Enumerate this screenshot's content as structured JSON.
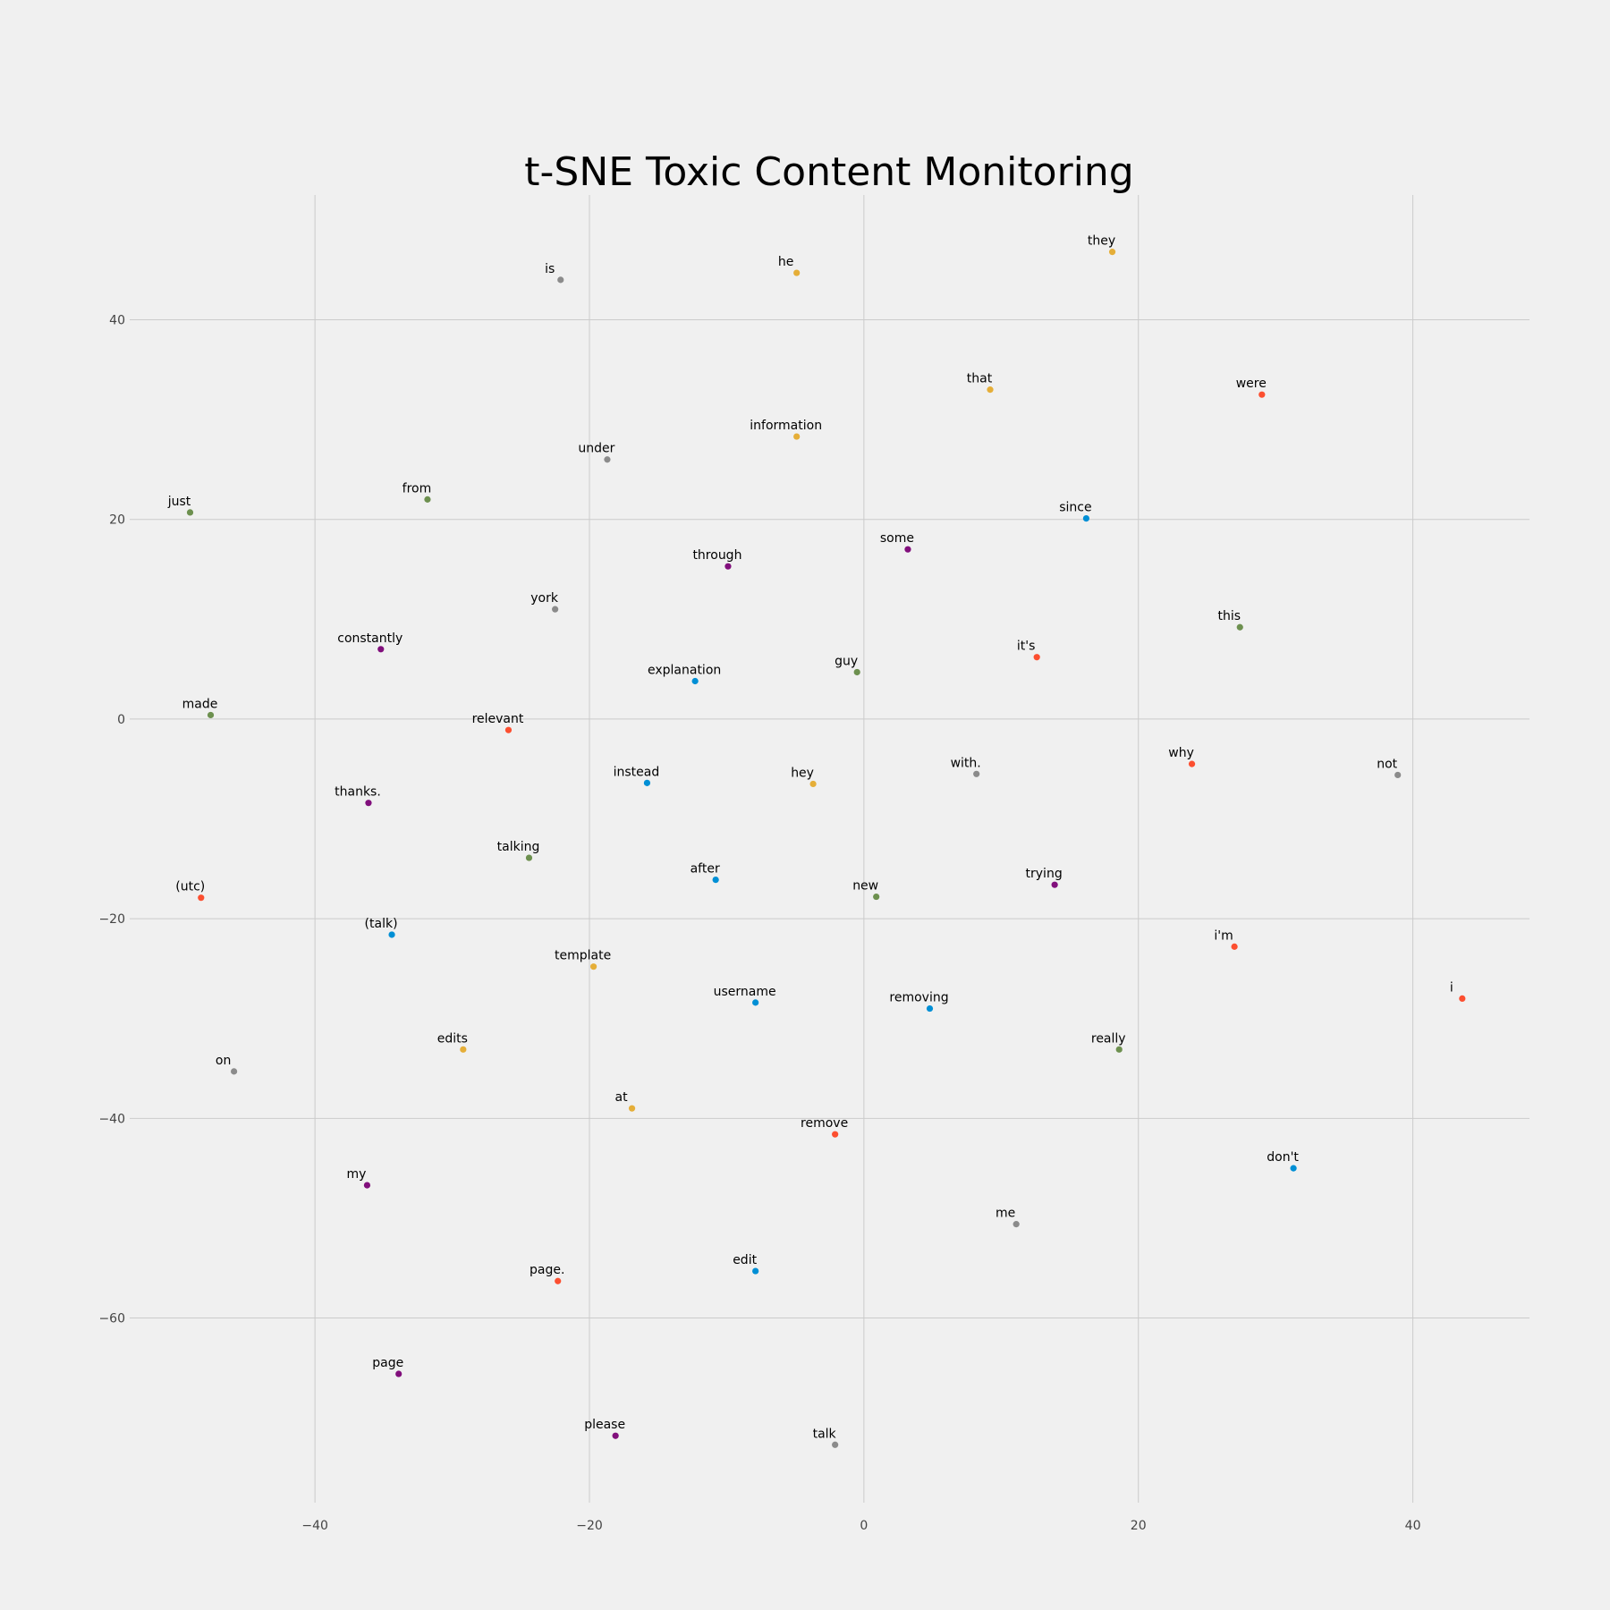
{
  "chart_data": {
    "type": "scatter",
    "title": "t-SNE Toxic Content Monitoring",
    "xlabel": "",
    "ylabel": "",
    "xlim": [
      -53.5,
      48.5
    ],
    "ylim": [
      -78.5,
      52.5
    ],
    "xticks": [
      -40,
      -20,
      0,
      20,
      40
    ],
    "yticks": [
      40,
      20,
      0,
      -20,
      -40,
      -60
    ],
    "xtick_labels": [
      "−40",
      "−20",
      "0",
      "20",
      "40"
    ],
    "ytick_labels": [
      "40",
      "20",
      "0",
      "−20",
      "−40",
      "−60"
    ],
    "grid": true,
    "colors": {
      "blue": "#008fd5",
      "red": "#fc4f30",
      "yellow": "#e5ae38",
      "green": "#6d904f",
      "gray": "#8b8b8b",
      "purple": "#810f7c"
    },
    "points": [
      {
        "label": "they",
        "x": 18.1,
        "y": 46.8,
        "color": "yellow"
      },
      {
        "label": "he",
        "x": -4.9,
        "y": 44.7,
        "color": "yellow"
      },
      {
        "label": "is",
        "x": -22.1,
        "y": 44.0,
        "color": "gray"
      },
      {
        "label": "that",
        "x": 9.2,
        "y": 33.0,
        "color": "yellow"
      },
      {
        "label": "were",
        "x": 29.0,
        "y": 32.5,
        "color": "red"
      },
      {
        "label": "information",
        "x": -4.9,
        "y": 28.3,
        "color": "yellow"
      },
      {
        "label": "under",
        "x": -18.7,
        "y": 26.0,
        "color": "gray"
      },
      {
        "label": "from",
        "x": -31.8,
        "y": 22.0,
        "color": "green"
      },
      {
        "label": "just",
        "x": -49.1,
        "y": 20.7,
        "color": "green"
      },
      {
        "label": "since",
        "x": 16.2,
        "y": 20.1,
        "color": "blue"
      },
      {
        "label": "some",
        "x": 3.2,
        "y": 17.0,
        "color": "purple"
      },
      {
        "label": "through",
        "x": -9.9,
        "y": 15.3,
        "color": "purple"
      },
      {
        "label": "york",
        "x": -22.5,
        "y": 11.0,
        "color": "gray"
      },
      {
        "label": "this",
        "x": 27.4,
        "y": 9.2,
        "color": "green"
      },
      {
        "label": "constantly",
        "x": -35.2,
        "y": 7.0,
        "color": "purple"
      },
      {
        "label": "it's",
        "x": 12.6,
        "y": 6.2,
        "color": "red"
      },
      {
        "label": "guy",
        "x": -0.5,
        "y": 4.7,
        "color": "green"
      },
      {
        "label": "explanation",
        "x": -12.3,
        "y": 3.8,
        "color": "blue"
      },
      {
        "label": "made",
        "x": -47.6,
        "y": 0.4,
        "color": "green"
      },
      {
        "label": "relevant",
        "x": -25.9,
        "y": -1.1,
        "color": "red"
      },
      {
        "label": "why",
        "x": 23.9,
        "y": -4.5,
        "color": "red"
      },
      {
        "label": "with.",
        "x": 8.2,
        "y": -5.5,
        "color": "gray"
      },
      {
        "label": "not",
        "x": 38.9,
        "y": -5.6,
        "color": "gray"
      },
      {
        "label": "instead",
        "x": -15.8,
        "y": -6.4,
        "color": "blue"
      },
      {
        "label": "hey",
        "x": -3.7,
        "y": -6.5,
        "color": "yellow"
      },
      {
        "label": "thanks.",
        "x": -36.1,
        "y": -8.4,
        "color": "purple"
      },
      {
        "label": "talking",
        "x": -24.4,
        "y": -13.9,
        "color": "green"
      },
      {
        "label": "after",
        "x": -10.8,
        "y": -16.1,
        "color": "blue"
      },
      {
        "label": "trying",
        "x": 13.9,
        "y": -16.6,
        "color": "purple"
      },
      {
        "label": "new",
        "x": 0.9,
        "y": -17.8,
        "color": "green"
      },
      {
        "label": "(utc)",
        "x": -48.3,
        "y": -17.9,
        "color": "red"
      },
      {
        "label": "(talk)",
        "x": -34.4,
        "y": -21.6,
        "color": "blue"
      },
      {
        "label": "i'm",
        "x": 27.0,
        "y": -22.8,
        "color": "red"
      },
      {
        "label": "template",
        "x": -19.7,
        "y": -24.8,
        "color": "yellow"
      },
      {
        "label": "i",
        "x": 43.6,
        "y": -28.0,
        "color": "red"
      },
      {
        "label": "username",
        "x": -7.9,
        "y": -28.4,
        "color": "blue"
      },
      {
        "label": "removing",
        "x": 4.8,
        "y": -29.0,
        "color": "blue"
      },
      {
        "label": "edits",
        "x": -29.2,
        "y": -33.1,
        "color": "yellow"
      },
      {
        "label": "really",
        "x": 18.6,
        "y": -33.1,
        "color": "green"
      },
      {
        "label": "on",
        "x": -45.9,
        "y": -35.3,
        "color": "gray"
      },
      {
        "label": "at",
        "x": -16.9,
        "y": -39.0,
        "color": "yellow"
      },
      {
        "label": "remove",
        "x": -2.1,
        "y": -41.6,
        "color": "red"
      },
      {
        "label": "don't",
        "x": 31.3,
        "y": -45.0,
        "color": "blue"
      },
      {
        "label": "my",
        "x": -36.2,
        "y": -46.7,
        "color": "purple"
      },
      {
        "label": "me",
        "x": 11.1,
        "y": -50.6,
        "color": "gray"
      },
      {
        "label": "edit",
        "x": -7.9,
        "y": -55.3,
        "color": "blue"
      },
      {
        "label": "page.",
        "x": -22.3,
        "y": -56.3,
        "color": "red"
      },
      {
        "label": "page",
        "x": -33.9,
        "y": -65.6,
        "color": "purple"
      },
      {
        "label": "please",
        "x": -18.1,
        "y": -71.8,
        "color": "purple"
      },
      {
        "label": "talk",
        "x": -2.1,
        "y": -72.7,
        "color": "gray"
      }
    ]
  }
}
